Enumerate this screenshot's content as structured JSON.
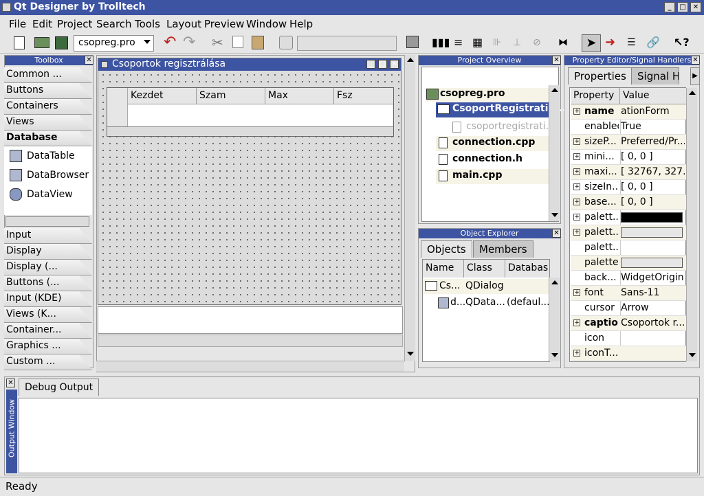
{
  "window": {
    "title": "Qt Designer by Trolltech"
  },
  "menu": [
    "File",
    "Edit",
    "Project",
    "Search",
    "Tools",
    "Layout",
    "Preview",
    "Window",
    "Help"
  ],
  "toolbar": {
    "project_combo": "csopreg.pro"
  },
  "toolbox": {
    "title": "Toolbox",
    "top_categories": [
      "Common ...",
      "Buttons",
      "Containers",
      "Views",
      "Database"
    ],
    "database_items": [
      "DataTable",
      "DataBrowser",
      "DataView"
    ],
    "bottom_categories": [
      "Input",
      "Display",
      "Display (...",
      "Buttons (...",
      "Input (KDE)",
      "Views (K...",
      "Container...",
      "Graphics ...",
      "Custom ..."
    ]
  },
  "form": {
    "title": "Csoportok regisztrálása",
    "columns": [
      "Kezdet",
      "Szam",
      "Max",
      "Fsz"
    ]
  },
  "project_overview": {
    "title": "Project Overview",
    "items": [
      "csopreg.pro",
      "CsoportRegistratio...",
      "csoportregistrati...",
      "connection.cpp",
      "connection.h",
      "main.cpp"
    ]
  },
  "object_explorer": {
    "title": "Object Explorer",
    "tabs": [
      "Objects",
      "Members"
    ],
    "columns": [
      "Name",
      "Class",
      "Databas"
    ],
    "rows": [
      {
        "name": "Cs...",
        "class": "QDialog",
        "db": ""
      },
      {
        "name": "d...",
        "class": "QData...",
        "db": "(defaul..."
      }
    ]
  },
  "property_editor": {
    "title": "Property Editor/Signal Handlers",
    "tabs": [
      "Properties",
      "Signal Ha"
    ],
    "columns": [
      "Property",
      "Value"
    ],
    "rows": [
      {
        "name": "name",
        "value": "ationForm",
        "expand": true,
        "bold": true
      },
      {
        "name": "enabled",
        "value": "True",
        "expand": false
      },
      {
        "name": "sizeP...",
        "value": "Preferred/Pr...",
        "expand": true
      },
      {
        "name": "mini...",
        "value": "[ 0, 0 ]",
        "expand": true
      },
      {
        "name": "maxi...",
        "value": "[ 32767, 327...",
        "expand": true
      },
      {
        "name": "sizeIn...",
        "value": "[ 0, 0 ]",
        "expand": true
      },
      {
        "name": "base...",
        "value": "[ 0, 0 ]",
        "expand": true
      },
      {
        "name": "palett...",
        "value": "",
        "expand": true,
        "swatch": "#000000"
      },
      {
        "name": "palett...",
        "value": "",
        "expand": true,
        "swatch": "#e6e6e6"
      },
      {
        "name": "palett...",
        "value": "",
        "expand": false
      },
      {
        "name": "palette",
        "value": "",
        "expand": false,
        "swatch": "#e6e6e6"
      },
      {
        "name": "back...",
        "value": "WidgetOrigin",
        "expand": false
      },
      {
        "name": "font",
        "value": "Sans-11",
        "expand": true
      },
      {
        "name": "cursor",
        "value": "Arrow",
        "expand": false
      },
      {
        "name": "caption",
        "value": "Csoportok r...",
        "expand": true,
        "bold": true
      },
      {
        "name": "icon",
        "value": "",
        "expand": false
      },
      {
        "name": "iconT...",
        "value": "",
        "expand": true
      }
    ]
  },
  "output": {
    "side_label": "Output Window",
    "tab": "Debug Output"
  },
  "status": {
    "text": "Ready"
  }
}
